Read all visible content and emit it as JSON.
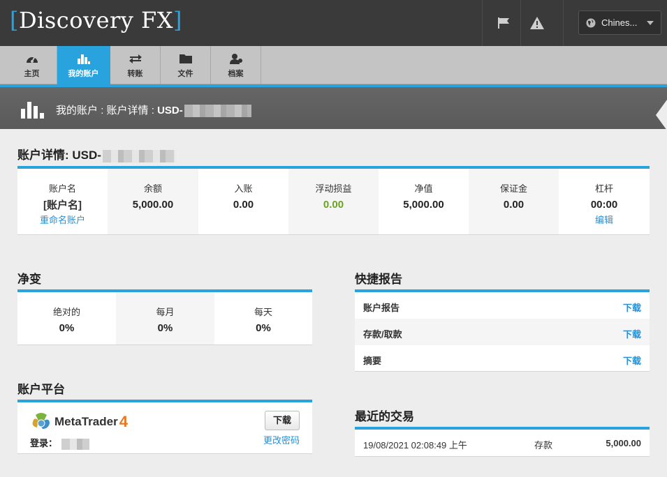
{
  "header": {
    "logo_text": "Discovery FX",
    "logo_bracket_open": "[",
    "logo_bracket_close": "]",
    "language": "Chines..."
  },
  "nav": [
    {
      "label": "主页",
      "icon": "dashboard-icon"
    },
    {
      "label": "我的账户",
      "icon": "bar-chart-icon",
      "active": true
    },
    {
      "label": "转账",
      "icon": "transfer-icon"
    },
    {
      "label": "文件",
      "icon": "folder-icon"
    },
    {
      "label": "档案",
      "icon": "profile-icon"
    }
  ],
  "breadcrumb": {
    "part1": "我的账户",
    "sep": ":",
    "part2": "账户详情",
    "account_prefix": "USD-"
  },
  "account_details": {
    "title": "账户详情: USD-",
    "columns": [
      {
        "label": "账户名",
        "value": "[账户名]",
        "link": "重命名账户"
      },
      {
        "label": "余额",
        "value": "5,000.00"
      },
      {
        "label": "入账",
        "value": "0.00"
      },
      {
        "label": "浮动损益",
        "value": "0.00"
      },
      {
        "label": "净值",
        "value": "5,000.00"
      },
      {
        "label": "保证金",
        "value": "0.00"
      },
      {
        "label": "杠杆",
        "value": "00:00",
        "link": "编辑"
      }
    ]
  },
  "net_change": {
    "title": "净变",
    "columns": [
      {
        "label": "绝对的",
        "value": "0%"
      },
      {
        "label": "每月",
        "value": "0%"
      },
      {
        "label": "每天",
        "value": "0%"
      }
    ]
  },
  "platform": {
    "title": "账户平台",
    "name": "MetaTrader",
    "version": "4",
    "login_label": "登录：",
    "download_label": "下载",
    "change_password_label": "更改密码"
  },
  "quick_reports": {
    "title": "快捷报告",
    "rows": [
      {
        "name": "账户报告",
        "action": "下载"
      },
      {
        "name": "存款/取款",
        "action": "下载"
      },
      {
        "name": "摘要",
        "action": "下载"
      }
    ]
  },
  "recent_trades": {
    "title": "最近的交易",
    "rows": [
      {
        "datetime": "19/08/2021 02:08:49 上午",
        "type": "存款",
        "amount": "5,000.00"
      }
    ]
  },
  "colors": {
    "accent": "#29a3dd",
    "link": "#2a8fd0",
    "positive": "#6aa321",
    "header_bg": "#3a3a3a"
  }
}
